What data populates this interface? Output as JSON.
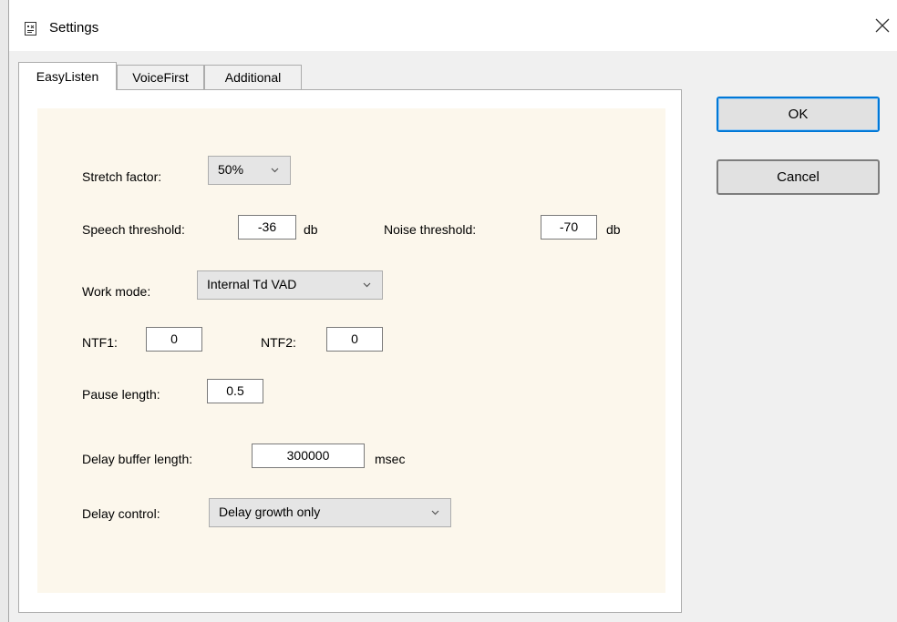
{
  "window": {
    "title": "Settings",
    "icon": "settings-dialog-icon",
    "close_icon": "close-icon"
  },
  "tabs": [
    {
      "label": "EasyListen",
      "active": true
    },
    {
      "label": "VoiceFirst",
      "active": false
    },
    {
      "label": "Additional",
      "active": false
    }
  ],
  "form": {
    "stretch_factor": {
      "label": "Stretch factor:",
      "value": "50%"
    },
    "speech_threshold": {
      "label": "Speech threshold:",
      "value": "-36",
      "unit": "db"
    },
    "noise_threshold": {
      "label": "Noise threshold:",
      "value": "-70",
      "unit": "db"
    },
    "work_mode": {
      "label": "Work mode:",
      "value": "Internal Td VAD"
    },
    "ntf1": {
      "label": "NTF1:",
      "value": "0"
    },
    "ntf2": {
      "label": "NTF2:",
      "value": "0"
    },
    "pause_length": {
      "label": "Pause length:",
      "value": "0.5"
    },
    "delay_buffer": {
      "label": "Delay buffer length:",
      "value": "300000",
      "unit": "msec"
    },
    "delay_control": {
      "label": "Delay control:",
      "value": "Delay growth only"
    }
  },
  "buttons": {
    "ok": "OK",
    "cancel": "Cancel"
  },
  "colors": {
    "panel_bg": "#fcf7ec",
    "default_button_border": "#0078d7"
  }
}
